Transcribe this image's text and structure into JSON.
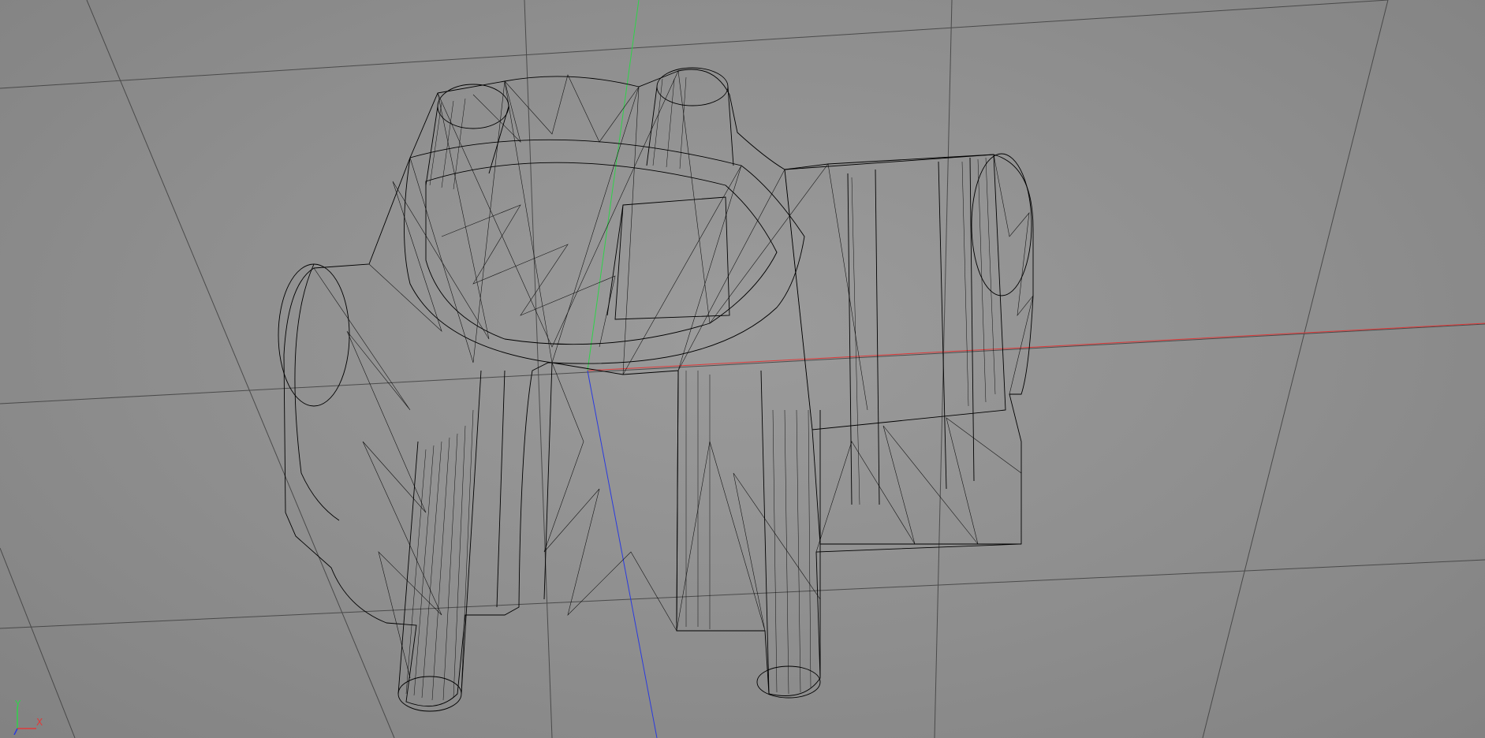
{
  "viewport": {
    "mode": "wireframe",
    "background_color": "#8f8f8f",
    "grid_color": "#3a3a3a",
    "wire_color": "#000000",
    "axes": {
      "x": {
        "label": "X",
        "color": "#e03a3a"
      },
      "y": {
        "label": "Y",
        "color": "#2fd24a"
      },
      "z": {
        "color": "#2a3adf"
      }
    }
  }
}
